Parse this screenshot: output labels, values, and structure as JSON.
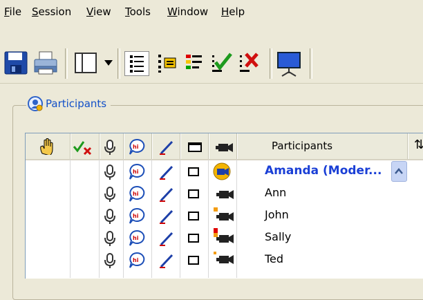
{
  "menu": [
    "File",
    "Session",
    "View",
    "Tools",
    "Window",
    "Help"
  ],
  "toolbar": {
    "icons": [
      "save-icon",
      "print-icon",
      "layout-icon",
      "dropdown-icon",
      "list-icon",
      "chat-toggle-icon",
      "status-icon",
      "approve-icon",
      "reject-icon",
      "presentation-icon"
    ]
  },
  "participants_panel": {
    "title": "Participants",
    "header": {
      "participants_label": "Participants",
      "sort_icon": "⇅"
    },
    "rows": [
      {
        "name": "Amanda (Moder...",
        "moderator": true,
        "cam_status": "active",
        "cam_level": 0
      },
      {
        "name": "Ann",
        "moderator": false,
        "cam_status": "none",
        "cam_level": 0
      },
      {
        "name": "John",
        "moderator": false,
        "cam_status": "level",
        "cam_level": 1
      },
      {
        "name": "Sally",
        "moderator": false,
        "cam_status": "level",
        "cam_level": 2
      },
      {
        "name": "Ted",
        "moderator": false,
        "cam_status": "none",
        "cam_level": 0
      }
    ]
  },
  "colors": {
    "accent": "#1a3fd6",
    "panel_title": "#1250c8",
    "background": "#ece9d8"
  }
}
